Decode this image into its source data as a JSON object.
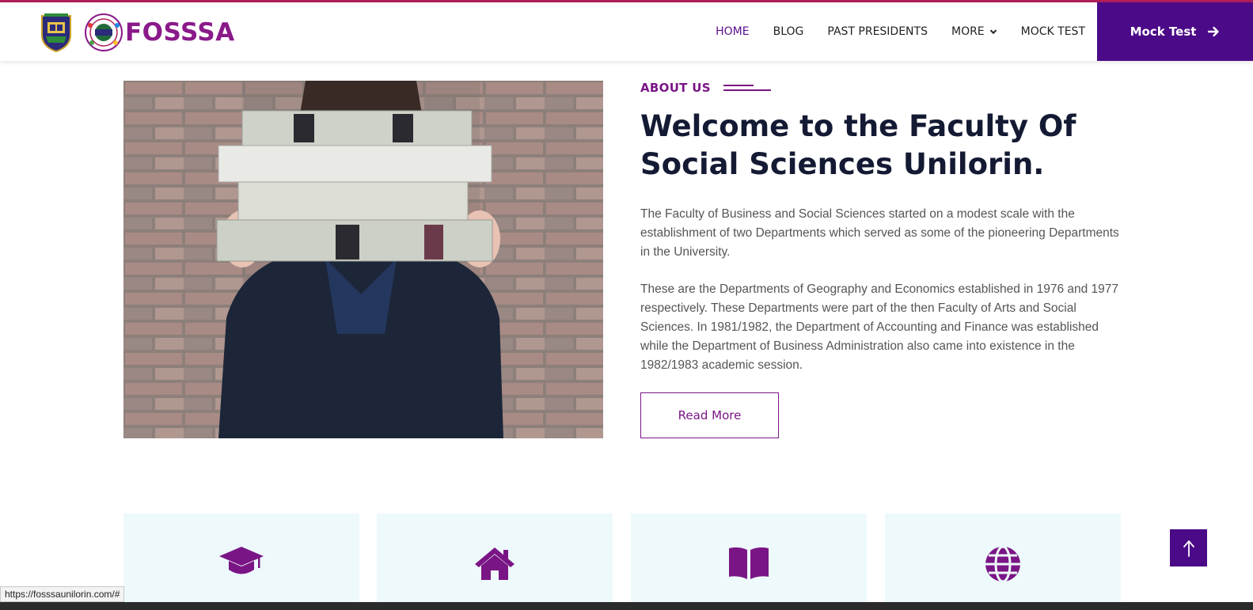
{
  "brand": {
    "name": "FOSSSA"
  },
  "nav": {
    "items": [
      {
        "label": "HOME",
        "active": true
      },
      {
        "label": "BLOG"
      },
      {
        "label": "PAST PRESIDENTS"
      },
      {
        "label": "MORE",
        "dropdown": true
      },
      {
        "label": "MOCK TEST"
      }
    ],
    "cta_label": "Mock Test"
  },
  "about": {
    "tag": "ABOUT US",
    "headline": "Welcome to the Faculty Of Social Sciences Unilorin.",
    "paragraphs": [
      "The Faculty of Business and Social Sciences started on a modest scale with the establishment of two Departments which served as some of the pioneering Departments in the University.",
      "These are the Departments of Geography and Economics established in 1976 and 1977 respectively. These Departments were part of the then Faculty of Arts and Social Sciences. In 1981/1982, the Department of Accounting and Finance was established while the Department of Business Administration also came into existence in the 1982/1983 academic session."
    ],
    "button_label": "Read More"
  },
  "feature_cards": [
    {
      "icon": "graduation-cap-icon"
    },
    {
      "icon": "home-icon"
    },
    {
      "icon": "book-open-icon"
    },
    {
      "icon": "globe-icon"
    }
  ],
  "status_bar": {
    "url": "https://fosssaunilorin.com/#"
  },
  "colors": {
    "brand_purple": "#4b0a87",
    "accent_magenta": "#7a1585",
    "card_bg": "#eef9fb",
    "top_line": "#b01f5a"
  }
}
